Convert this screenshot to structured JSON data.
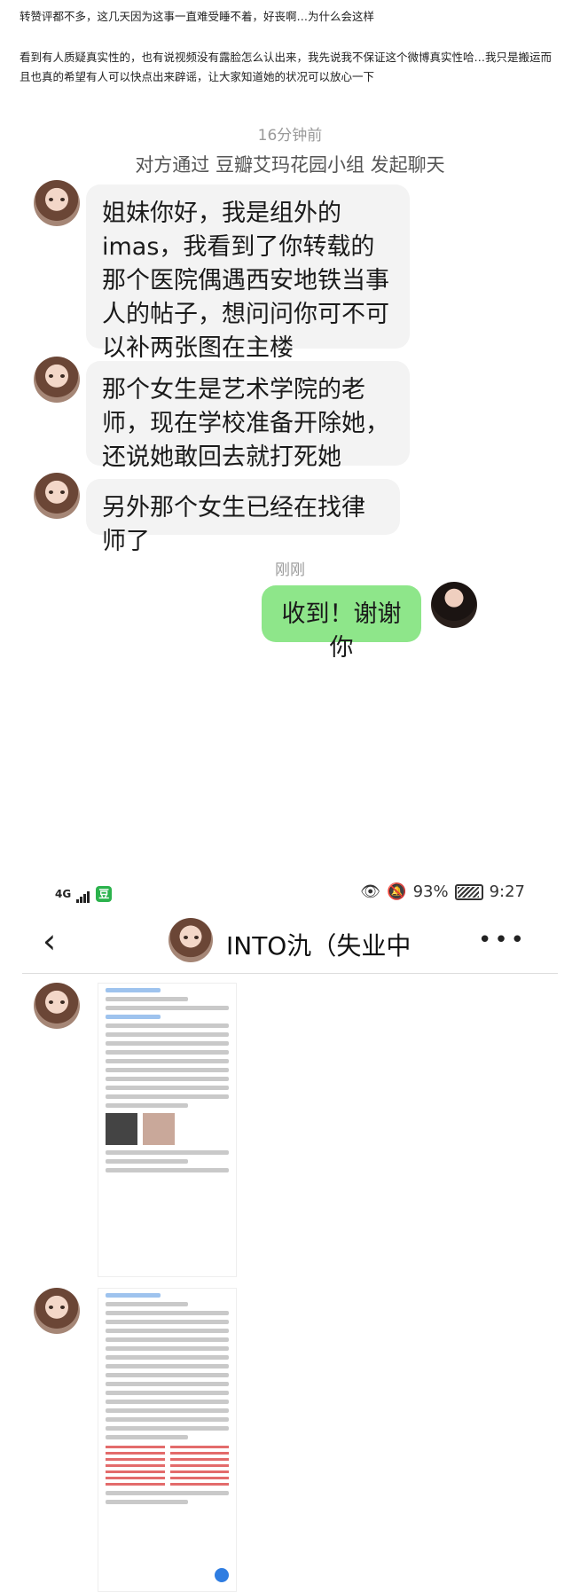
{
  "post": {
    "line1": "转赞评都不多，这几天因为这事一直难受睡不着，好丧啊…为什么会这样",
    "line2": "看到有人质疑真实性的，也有说视频没有露脸怎么认出来，我先说我不保证这个微博真实性哈…我只是搬运而且也真的希望有人可以快点出来辟谣，让大家知道她的状况可以放心一下"
  },
  "chat1": {
    "time1": "16分钟前",
    "system": "对方通过 豆瓣艾玛花园小组 发起聊天",
    "messages": [
      "姐妹你好，我是组外的imas，我看到了你转载的那个医院偶遇西安地铁当事人的帖子，想问问你可不可以补两张图在主楼",
      "那个女生是艺术学院的老师，现在学校准备开除她，还说她敢回去就打死她",
      "另外那个女生已经在找律师了"
    ],
    "time2": "刚刚",
    "reply": "收到！谢谢你"
  },
  "status_bar": {
    "network": "4G",
    "app_icon": "豆",
    "battery": "93%",
    "time": "9:27"
  },
  "chat2": {
    "back_icon": "chevron-left-icon",
    "title": "INTO氿（失业中",
    "more": "•••"
  }
}
